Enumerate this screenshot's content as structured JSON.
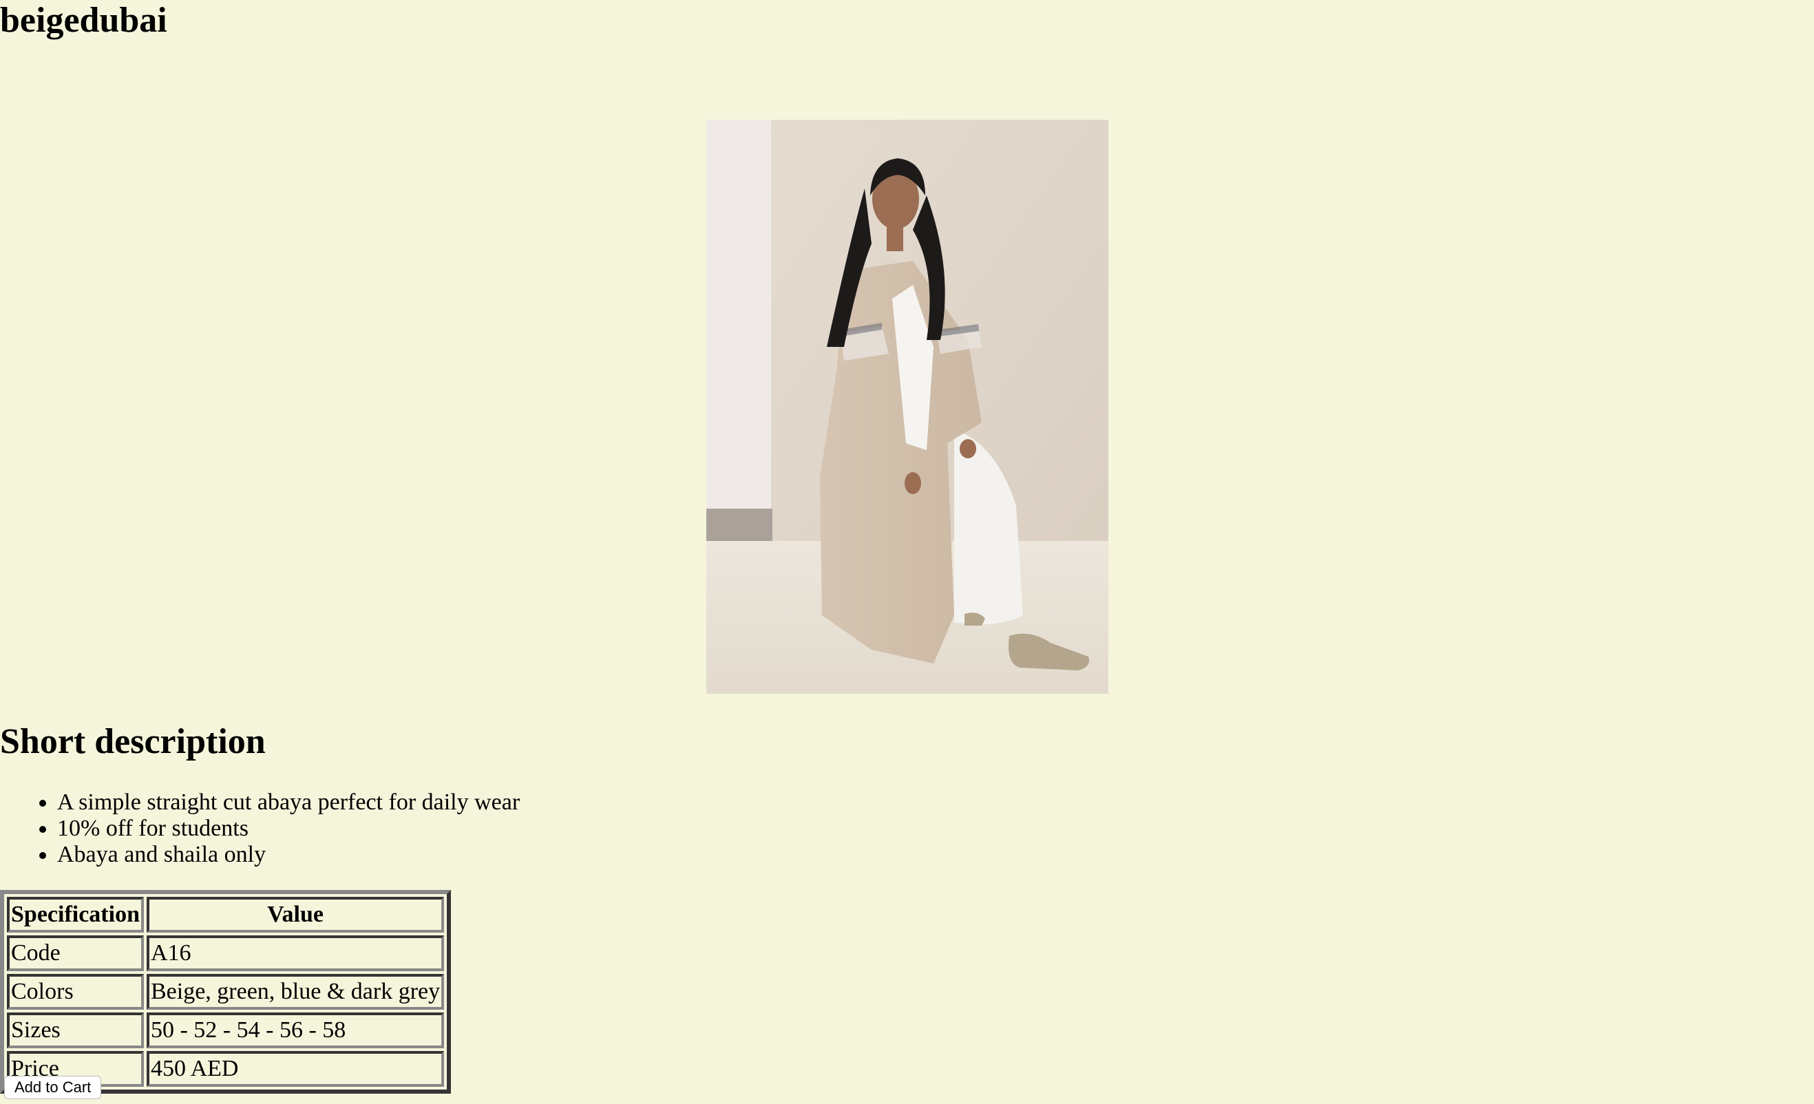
{
  "site": {
    "title": "beigedubai"
  },
  "product": {
    "image_description_name": "abaya-photo"
  },
  "description": {
    "heading": "Short description",
    "bullets": [
      "A simple straight cut abaya perfect for daily wear",
      "10% off for students",
      "Abaya and shaila only"
    ]
  },
  "specs": {
    "headers": [
      "Specification",
      "Value"
    ],
    "rows": [
      {
        "spec": "Code",
        "value": "A16"
      },
      {
        "spec": "Colors",
        "value": "Beige, green, blue & dark grey"
      },
      {
        "spec": "Sizes",
        "value": "50 - 52 - 54 - 56 - 58"
      },
      {
        "spec": "Price",
        "value": "450 AED"
      }
    ]
  },
  "actions": {
    "add_to_cart_label": "Add to Cart"
  },
  "colors": {
    "page_background": "#f5f5dc"
  }
}
